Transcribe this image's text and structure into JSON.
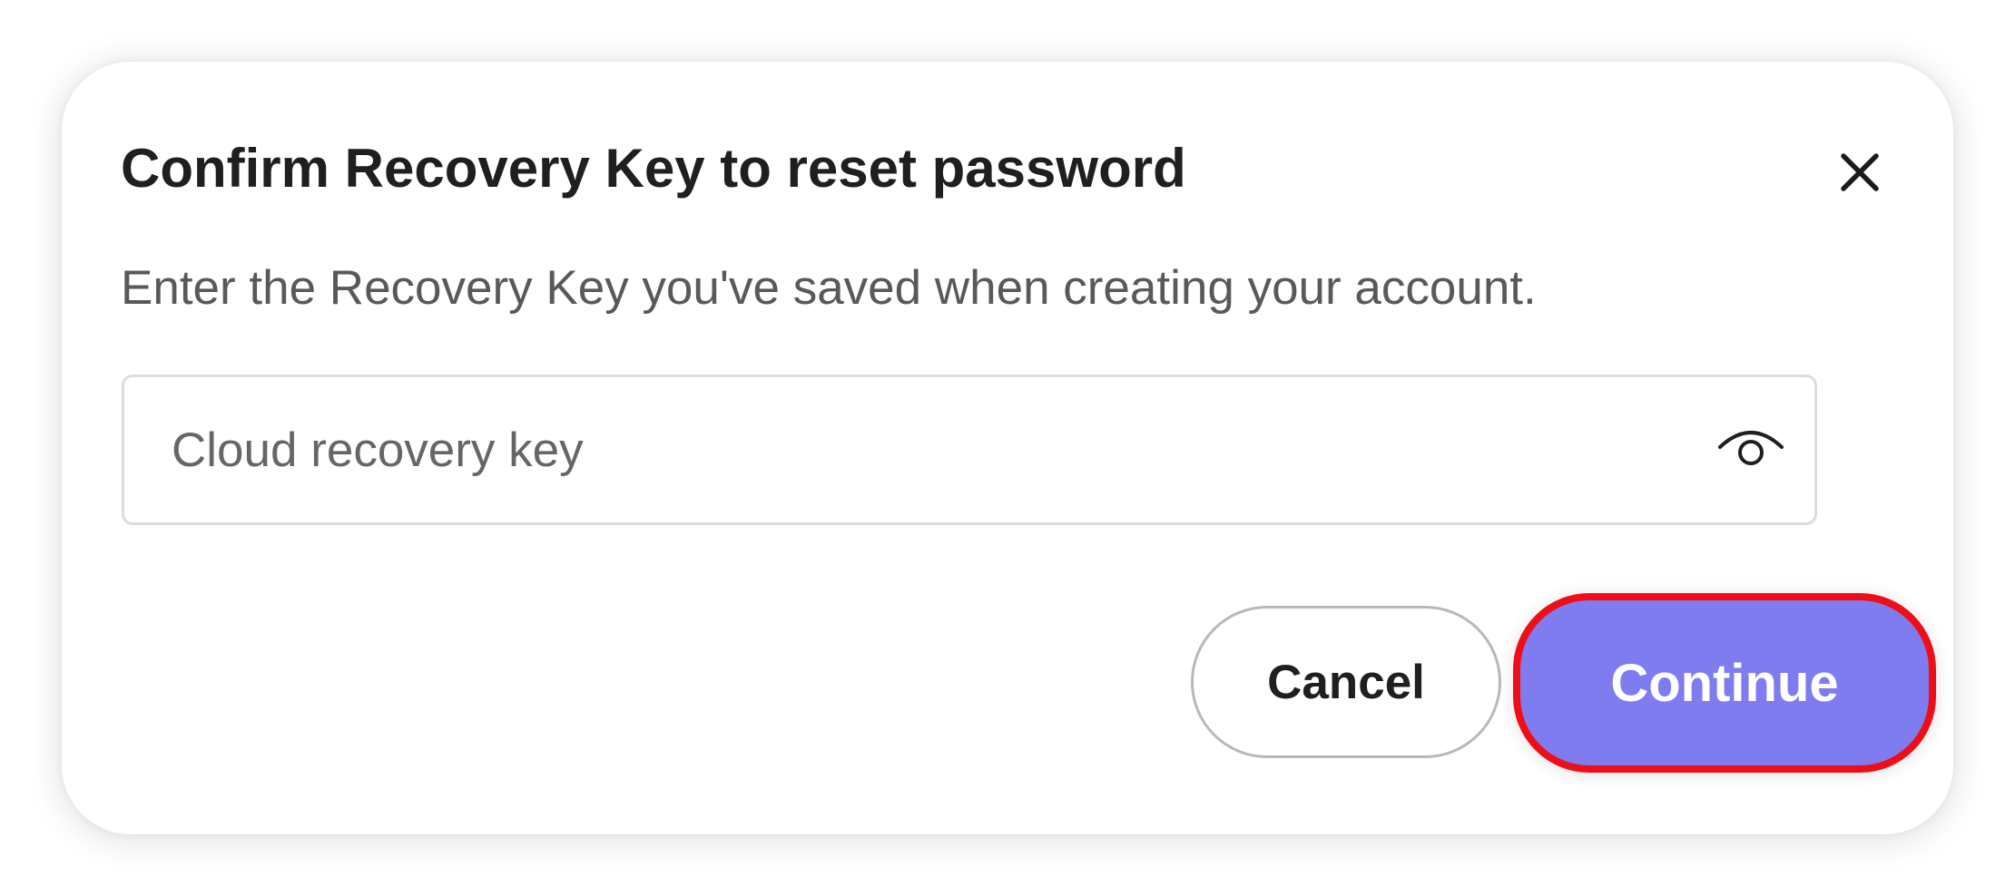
{
  "dialog": {
    "title": "Confirm Recovery Key to reset password",
    "subtitle": "Enter the Recovery Key you've saved when creating your account.",
    "close_icon": "close-icon"
  },
  "input": {
    "value": "",
    "placeholder": "Cloud recovery key",
    "toggle_icon": "eye-icon"
  },
  "buttons": {
    "cancel_label": "Cancel",
    "continue_label": "Continue"
  },
  "colors": {
    "primary": "#7f7cf0",
    "highlight_outline": "#ee0e17",
    "title_text": "#1f1f1f",
    "secondary_text": "#595959"
  }
}
